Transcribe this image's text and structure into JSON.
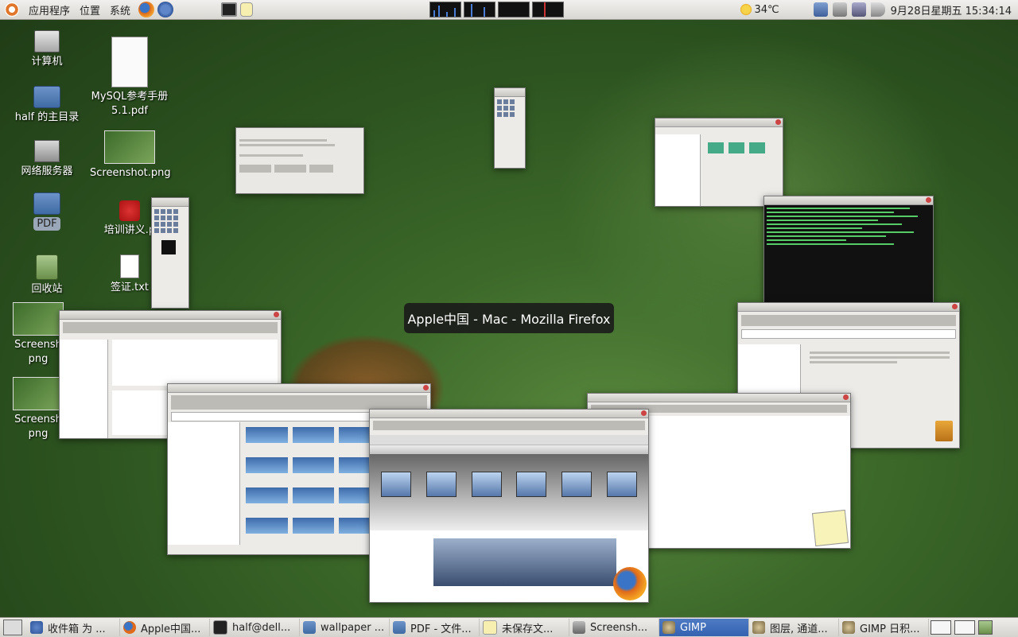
{
  "top_panel": {
    "menus": [
      "应用程序",
      "位置",
      "系统"
    ],
    "temperature": "34℃",
    "datetime": "9月28日星期五 15:34:14"
  },
  "desktop_icons": [
    {
      "label": "计算机",
      "icon": "computer-icon"
    },
    {
      "label": "half 的主目录",
      "icon": "home-folder-icon"
    },
    {
      "label": "网络服务器",
      "icon": "network-icon"
    },
    {
      "label": "PDF",
      "icon": "folder-icon"
    },
    {
      "label": "回收站",
      "icon": "trash-icon"
    },
    {
      "label": "MySQL参考手册5.1.pdf",
      "icon": "pdf-file-icon"
    },
    {
      "label": "Screenshot.png",
      "icon": "image-file-icon"
    },
    {
      "label": "培训讲义.p",
      "icon": "presentation-file-icon"
    },
    {
      "label": "签证.txt",
      "icon": "text-file-icon"
    },
    {
      "label": "Screensh png",
      "icon": "image-file-icon"
    },
    {
      "label": "Screensh png",
      "icon": "image-file-icon"
    }
  ],
  "tooltip": "Apple中国 - Mac - Mozilla Firefox",
  "taskbar": {
    "tasks": [
      {
        "label": "收件箱 为 ...",
        "icon": "mail-icon",
        "active": false
      },
      {
        "label": "Apple中国...",
        "icon": "firefox-icon",
        "active": false
      },
      {
        "label": "half@dell...",
        "icon": "terminal-icon",
        "active": false
      },
      {
        "label": "wallpaper ...",
        "icon": "folder-icon",
        "active": false
      },
      {
        "label": "PDF - 文件...",
        "icon": "folder-icon",
        "active": false
      },
      {
        "label": "未保存文...",
        "icon": "text-editor-icon",
        "active": false
      },
      {
        "label": "Screensh...",
        "icon": "screenshot-icon",
        "active": false
      },
      {
        "label": "GIMP",
        "icon": "gimp-icon",
        "active": true
      },
      {
        "label": "图层, 通道...",
        "icon": "gimp-icon",
        "active": false
      },
      {
        "label": "GIMP 日积...",
        "icon": "gimp-icon",
        "active": false
      }
    ]
  },
  "colors": {
    "accent": "#3462b0",
    "panel": "#e4e2de"
  }
}
